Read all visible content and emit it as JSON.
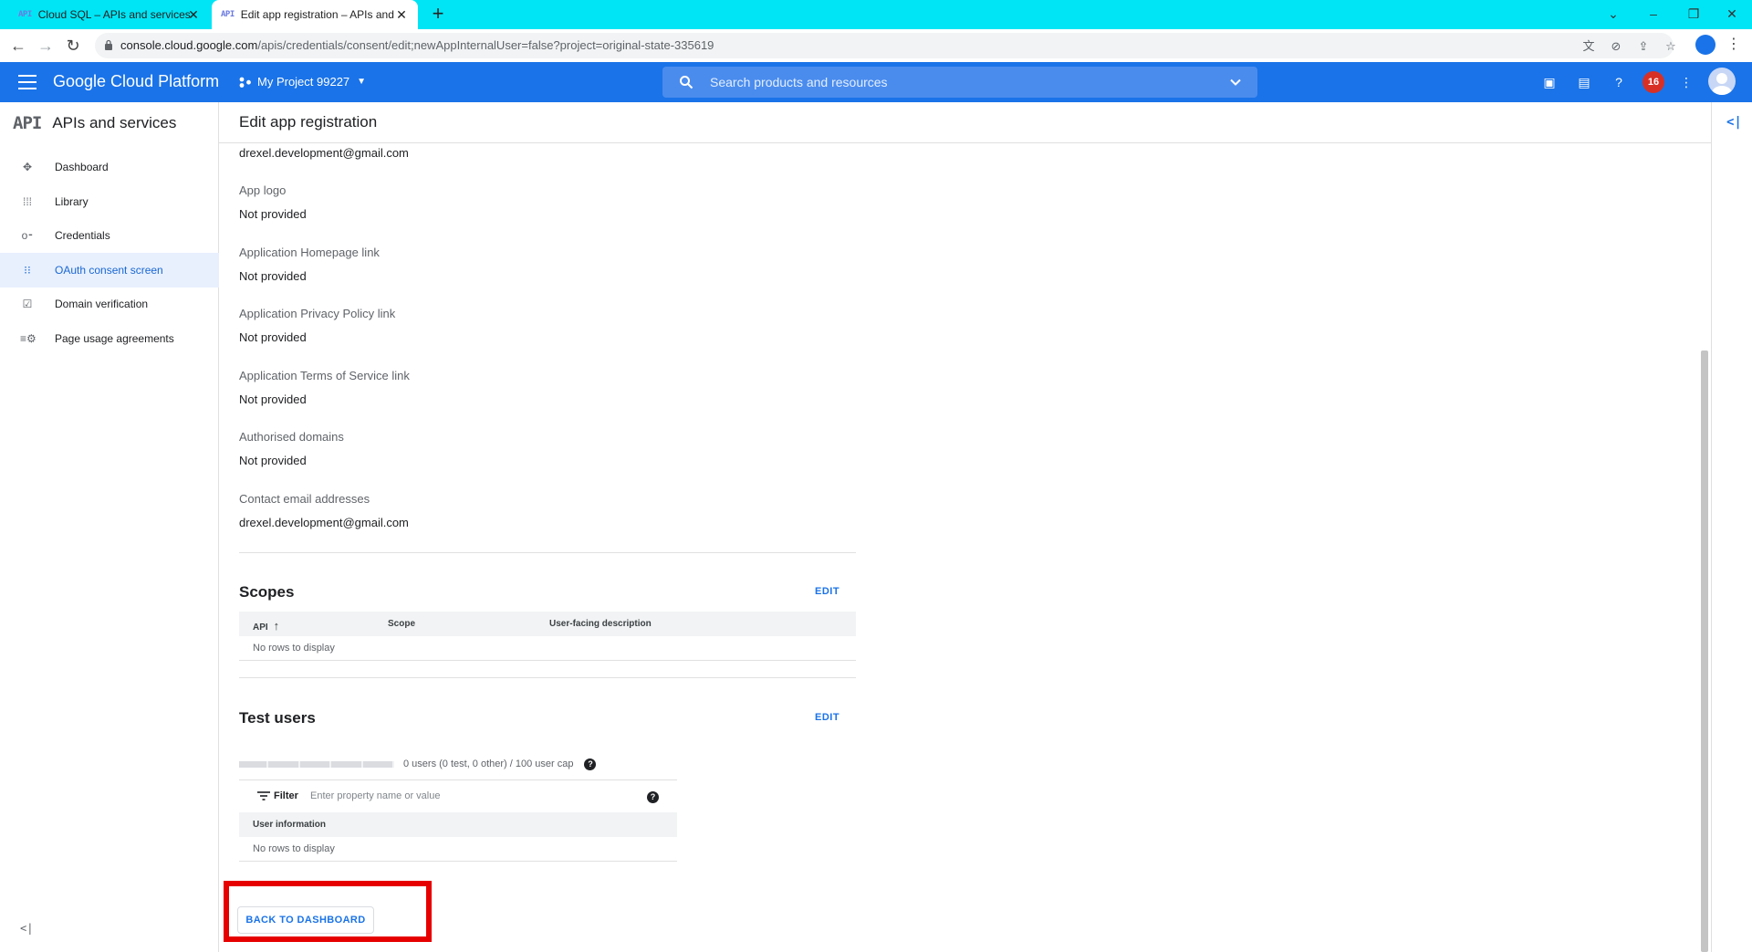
{
  "browser": {
    "tabs": [
      {
        "label": "Cloud SQL – APIs and services – ",
        "favicon": "API"
      },
      {
        "label": "Edit app registration – APIs and s",
        "favicon": "API"
      }
    ],
    "url_host": "console.cloud.google.com",
    "url_rest": "/apis/credentials/consent/edit;newAppInternalUser=false?project=original-state-335619"
  },
  "header": {
    "brand": "Google Cloud Platform",
    "project": "My Project 99227",
    "search_placeholder": "Search products and resources",
    "notification_count": "16"
  },
  "sidebar": {
    "logo": "API",
    "title": "APIs and services",
    "items": [
      {
        "label": "Dashboard",
        "icon": "dashboard-icon"
      },
      {
        "label": "Library",
        "icon": "library-icon"
      },
      {
        "label": "Credentials",
        "icon": "key-icon"
      },
      {
        "label": "OAuth consent screen",
        "icon": "consent-icon",
        "active": true
      },
      {
        "label": "Domain verification",
        "icon": "checkbox-icon"
      },
      {
        "label": "Page usage agreements",
        "icon": "settings-list-icon"
      }
    ]
  },
  "page": {
    "title": "Edit app registration",
    "top_email": "drexel.development@gmail.com",
    "fields": [
      {
        "label": "App logo",
        "value": "Not provided"
      },
      {
        "label": "Application Homepage link",
        "value": "Not provided"
      },
      {
        "label": "Application Privacy Policy link",
        "value": "Not provided"
      },
      {
        "label": "Application Terms of Service link",
        "value": "Not provided"
      },
      {
        "label": "Authorised domains",
        "value": "Not provided"
      },
      {
        "label": "Contact email addresses",
        "value": "drexel.development@gmail.com"
      }
    ],
    "scopes": {
      "title": "Scopes",
      "edit": "EDIT",
      "columns": [
        "API",
        "Scope",
        "User-facing description"
      ],
      "empty": "No rows to display"
    },
    "test_users": {
      "title": "Test users",
      "edit": "EDIT",
      "cap_text": "0 users (0 test, 0 other) / 100 user cap",
      "filter_label": "Filter",
      "filter_placeholder": "Enter property name or value",
      "column": "User information",
      "empty": "No rows to display"
    },
    "back_button": "BACK TO DASHBOARD"
  }
}
